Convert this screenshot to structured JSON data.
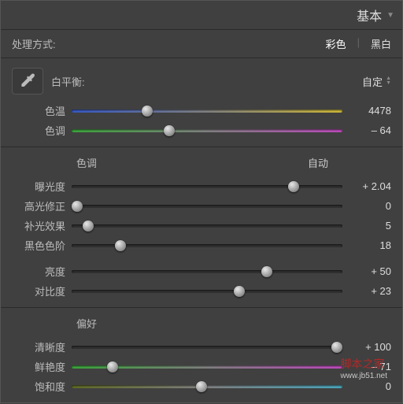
{
  "header": {
    "title": "基本"
  },
  "treatment": {
    "label": "处理方式:",
    "color": "彩色",
    "bw": "黑白"
  },
  "wb": {
    "label": "白平衡:",
    "value": "自定"
  },
  "temp": {
    "label": "色温",
    "value": "4478",
    "pos": 28
  },
  "tint": {
    "label": "色调",
    "value": "– 64",
    "pos": 36
  },
  "tone_section": {
    "label": "色调",
    "auto": "自动"
  },
  "exposure": {
    "label": "曝光度",
    "value": "+ 2.04",
    "pos": 82
  },
  "recovery": {
    "label": "高光修正",
    "value": "0",
    "pos": 2
  },
  "fill": {
    "label": "补光效果",
    "value": "5",
    "pos": 6
  },
  "blacks": {
    "label": "黑色色阶",
    "value": "18",
    "pos": 18
  },
  "brightness": {
    "label": "亮度",
    "value": "+ 50",
    "pos": 72
  },
  "contrast": {
    "label": "对比度",
    "value": "+ 23",
    "pos": 62
  },
  "presence_section": {
    "label": "偏好"
  },
  "clarity": {
    "label": "清晰度",
    "value": "+ 100",
    "pos": 98
  },
  "vibrance": {
    "label": "鲜艳度",
    "value": "– 71",
    "pos": 15
  },
  "saturation": {
    "label": "饱和度",
    "value": "0",
    "pos": 48
  },
  "watermark": {
    "line1": "脚本之家",
    "line2": "www.jb51.net"
  }
}
